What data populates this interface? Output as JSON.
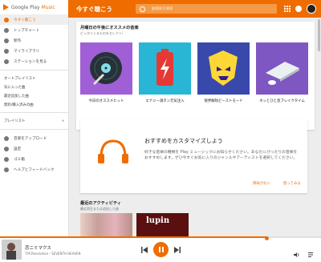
{
  "app": {
    "logo_prefix": "Google Play",
    "logo_suffix": "Music",
    "accent": "#ef6c00"
  },
  "header": {
    "title": "今すぐ聴こう",
    "search_placeholder": "曲検索を検索"
  },
  "sidebar": {
    "nav": [
      {
        "label": "今すぐ聴こう",
        "icon": "headphones-icon",
        "active": true
      },
      {
        "label": "トップチャート",
        "icon": "chart-icon",
        "active": false
      },
      {
        "label": "新作",
        "icon": "new-icon",
        "active": false
      },
      {
        "label": "マイライブラリ",
        "icon": "library-icon",
        "active": false
      },
      {
        "label": "ステーションを見る",
        "icon": "radio-icon",
        "active": false
      }
    ],
    "auto_playlist_title": "オートプレイリスト",
    "auto_playlists": [
      "気に入った曲",
      "最近追加した曲",
      "無料/購入済みの曲"
    ],
    "playlist_title": "プレイリスト",
    "playlist_add": "+",
    "bottom": [
      {
        "label": "音楽をアップロード",
        "icon": "upload-icon"
      },
      {
        "label": "設定",
        "icon": "settings-icon"
      },
      {
        "label": "ゴミ箱",
        "icon": "trash-icon"
      },
      {
        "label": "ヘルプとフィードバック",
        "icon": "help-icon"
      }
    ]
  },
  "recommend": {
    "title": "月曜日の午後にオススメの音楽",
    "subtitle": "ピッタリくるものをセレクト！",
    "tiles": [
      {
        "caption": "今日のオススメヒット",
        "bg": "#a05fd6"
      },
      {
        "caption": "エナジー満タン元気注入",
        "bg": "#29b6d6"
      },
      {
        "caption": "限界解除ビーストモード",
        "bg": "#3949ab"
      },
      {
        "caption": "ホッとひと息ブレイクタイム",
        "bg": "#7e57c2"
      }
    ]
  },
  "customize": {
    "title": "おすすめをカスタマイズしよう",
    "description": "好きな音楽の種類を Play ミュージックにお知らせください。あなたにぴったりの音楽をおすすめします。ぜひ今すぐお気に入りのジャンルやアーティストを選択してください。",
    "dismiss": "興味がない",
    "start": "使ってみる"
  },
  "recent": {
    "title": "最近のアクティビティ",
    "subtitle": "最近再生または追加した曲",
    "album2_text": "lupin"
  },
  "player": {
    "song": "恋ニミマクス",
    "artist": "T.M.Revolution - SEVENTH HEAVEN",
    "progress": 0.83
  }
}
